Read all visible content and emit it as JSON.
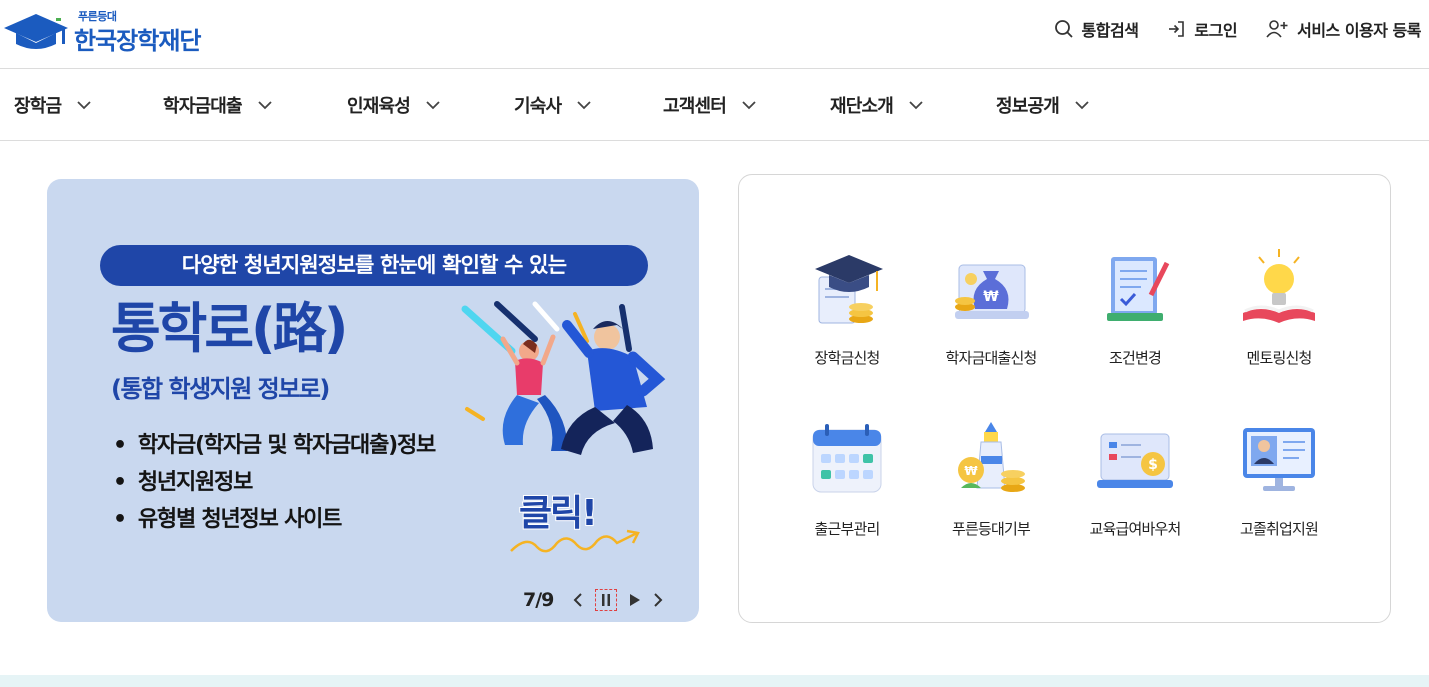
{
  "header": {
    "logo_sub": "푸른등대",
    "logo_main": "한국장학재단",
    "util": [
      {
        "label": "통합검색",
        "icon": "search-icon"
      },
      {
        "label": "로그인",
        "icon": "login-icon"
      },
      {
        "label": "서비스 이용자 등록",
        "icon": "user-add-icon"
      }
    ]
  },
  "gnb": {
    "items": [
      "장학금",
      "학자금대출",
      "인재육성",
      "기숙사",
      "고객센터",
      "재단소개",
      "정보공개"
    ]
  },
  "banner": {
    "pill": "다양한 청년지원정보를 한눈에 확인할 수 있는",
    "title": "통학로(路)",
    "subtitle": "(통합 학생지원 정보로)",
    "bullets": [
      "학자금(학자금 및 학자금대출)정보",
      "청년지원정보",
      "유형별 청년정보 사이트"
    ],
    "click": "클릭!",
    "pager": {
      "current": 7,
      "total": 9,
      "label": "7/9"
    }
  },
  "quick_menu": {
    "items": [
      {
        "label": "장학금신청",
        "icon": "graduation-cap-icon"
      },
      {
        "label": "학자금대출신청",
        "icon": "money-bag-icon"
      },
      {
        "label": "조건변경",
        "icon": "document-edit-icon"
      },
      {
        "label": "멘토링신청",
        "icon": "lightbulb-book-icon"
      },
      {
        "label": "출근부관리",
        "icon": "calendar-icon"
      },
      {
        "label": "푸른등대기부",
        "icon": "lighthouse-coins-icon"
      },
      {
        "label": "교육급여바우처",
        "icon": "voucher-icon"
      },
      {
        "label": "고졸취업지원",
        "icon": "job-monitor-icon"
      }
    ]
  },
  "colors": {
    "brand": "#1b5bbf",
    "banner_bg": "#c9d8ef",
    "banner_text": "#1f46a8"
  }
}
